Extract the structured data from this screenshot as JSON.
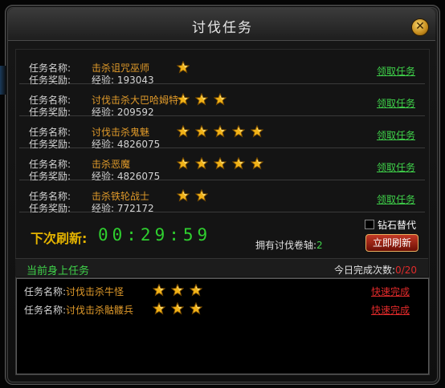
{
  "window": {
    "title": "讨伐任务",
    "close_icon": "close-icon"
  },
  "labels": {
    "task_name": "任务名称:",
    "task_reward": "任务奖励:",
    "reward_prefix": "经验:"
  },
  "tasks": [
    {
      "name": "击杀诅咒巫师",
      "exp": "193043",
      "stars": 1,
      "action": "领取任务"
    },
    {
      "name": "讨伐击杀大巴哈姆特",
      "exp": "209592",
      "stars": 3,
      "action": "领取任务"
    },
    {
      "name": "讨伐击杀鬼魅",
      "exp": "4826075",
      "stars": 5,
      "action": "领取任务"
    },
    {
      "name": "击杀恶魔",
      "exp": "4826075",
      "stars": 5,
      "action": "领取任务"
    },
    {
      "name": "击杀铁轮战士",
      "exp": "772172",
      "stars": 2,
      "action": "领取任务"
    }
  ],
  "refresh": {
    "next_label": "下次刷新:",
    "timer": "00:29:59",
    "diamond_label": "钻石替代",
    "owned_label": "拥有讨伐卷轴:",
    "owned_count": "2",
    "button_label": "立即刷新"
  },
  "current": {
    "title": "当前身上任务",
    "today_label": "今日完成次数:",
    "today_done": "0",
    "today_total": "/20",
    "tasks": [
      {
        "label": "任务名称:",
        "name": "讨伐击杀牛怪",
        "stars": 3,
        "action": "快速完成"
      },
      {
        "label": "任务名称:",
        "name": "讨伐击杀骷髅兵",
        "stars": 3,
        "action": "快速完成"
      }
    ]
  },
  "colors": {
    "accent_green": "#3fd24a",
    "task_orange": "#e09a2a",
    "star_gold": "#f2b318",
    "alert_red": "#e02a2a"
  }
}
